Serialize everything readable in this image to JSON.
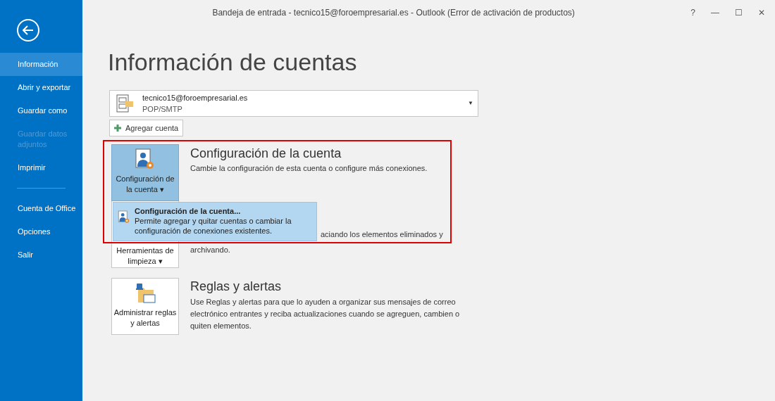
{
  "window": {
    "title": "Bandeja de entrada - tecnico15@foroempresarial.es - Outlook (Error de activación de productos)",
    "controls": [
      "?",
      "—",
      "☐",
      "✕"
    ]
  },
  "sidebar": {
    "items": [
      {
        "label": "Información",
        "selected": true,
        "disabled": false
      },
      {
        "label": "Abrir y exportar",
        "selected": false,
        "disabled": false
      },
      {
        "label": "Guardar como",
        "selected": false,
        "disabled": false
      },
      {
        "label": "Guardar datos adjuntos",
        "selected": false,
        "disabled": true
      },
      {
        "label": "Imprimir",
        "selected": false,
        "disabled": false
      },
      {
        "label": "Cuenta de Office",
        "selected": false,
        "disabled": false
      },
      {
        "label": "Opciones",
        "selected": false,
        "disabled": false
      },
      {
        "label": "Salir",
        "selected": false,
        "disabled": false
      }
    ]
  },
  "heading": "Información de cuentas",
  "account": {
    "email": "tecnico15@foroempresarial.es",
    "type": "POP/SMTP",
    "caret": "▼"
  },
  "add_account": "Agregar cuenta",
  "sections": [
    {
      "kind": "settings",
      "tile": "Configuración de la cuenta",
      "caret": "▾",
      "title": "Configuración de la cuenta",
      "description": "Cambie la configuración de esta cuenta o configure más conexiones."
    },
    {
      "kind": "cleanup",
      "tile": "Herramientas de limpieza",
      "caret": "▾",
      "description_parts": [
        "aciando los elementos eliminados y",
        "archivando."
      ]
    },
    {
      "kind": "rules",
      "tile": "Administrar reglas y alertas",
      "title": "Reglas y alertas",
      "description": "Use Reglas y alertas para que lo ayuden a organizar sus mensajes de correo electrónico entrantes y reciba actualizaciones cuando se agreguen, cambien o quiten elementos."
    }
  ],
  "dropdown": {
    "title": "Configuración de la cuenta...",
    "description": "Permite agregar y quitar cuentas o cambiar la configuración de conexiones existentes."
  }
}
